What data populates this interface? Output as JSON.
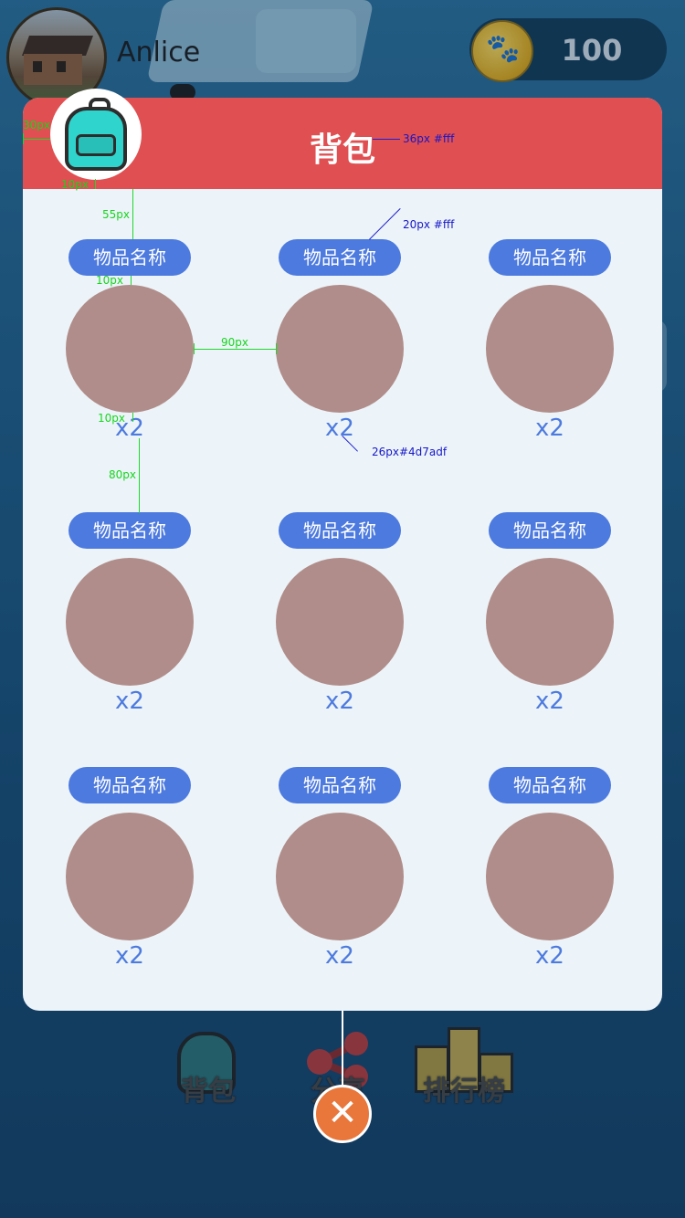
{
  "user": {
    "name": "Anlice"
  },
  "coins": {
    "count": "100",
    "icon": "paw-coin-icon"
  },
  "panel": {
    "title": "背包",
    "badge_icon": "backpack-icon"
  },
  "items": [
    {
      "name": "物品名称",
      "qty": "x2"
    },
    {
      "name": "物品名称",
      "qty": "x2"
    },
    {
      "name": "物品名称",
      "qty": "x2"
    },
    {
      "name": "物品名称",
      "qty": "x2"
    },
    {
      "name": "物品名称",
      "qty": "x2"
    },
    {
      "name": "物品名称",
      "qty": "x2"
    },
    {
      "name": "物品名称",
      "qty": "x2"
    },
    {
      "name": "物品名称",
      "qty": "x2"
    },
    {
      "name": "物品名称",
      "qty": "x2"
    }
  ],
  "annotations": {
    "title_spec": "36px #fff",
    "name_spec": "20px #fff",
    "qty_spec": "26px#4d7adf",
    "left_30": "30px",
    "gap_10_badge": "10px",
    "gap_55": "55px",
    "gap_10_name": "10px",
    "gap_90": "90px",
    "gap_10_qty": "10px",
    "gap_80": "80px"
  },
  "nav": {
    "bag": "背包",
    "share": "分享",
    "rank": "排行榜"
  },
  "colors": {
    "header": "#e04f51",
    "accent": "#4d7adf",
    "panel": "#ecf4f9",
    "close": "#e9773b"
  }
}
